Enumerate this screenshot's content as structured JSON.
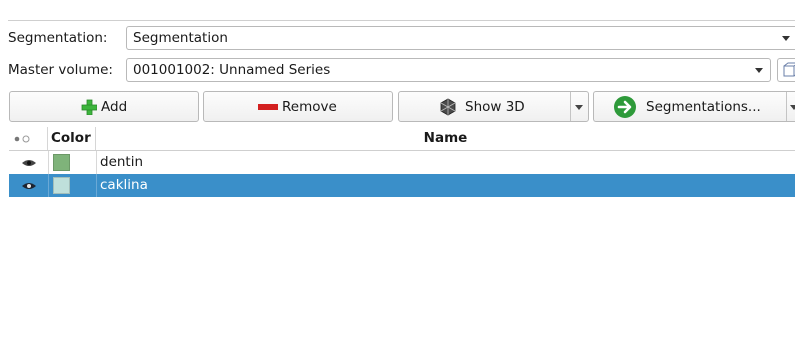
{
  "segmentation": {
    "label": "Segmentation:",
    "value": "Segmentation"
  },
  "master_volume": {
    "label": "Master volume:",
    "value": "001001002: Unnamed Series"
  },
  "toolbar": {
    "add_label": "Add",
    "remove_label": "Remove",
    "show3d_label": "Show 3D",
    "segmentations_label": "Segmentations..."
  },
  "table": {
    "columns": {
      "color": "Color",
      "name": "Name"
    },
    "rows": [
      {
        "name": "dentin",
        "color": "#7fb37a",
        "selected": false
      },
      {
        "name": "caklina",
        "color": "#bfe0db",
        "selected": true
      }
    ]
  },
  "colors": {
    "selection": "#3a8fc9",
    "add_green": "#3db53d",
    "remove_red": "#d32020",
    "go_green": "#2e9a3a"
  }
}
